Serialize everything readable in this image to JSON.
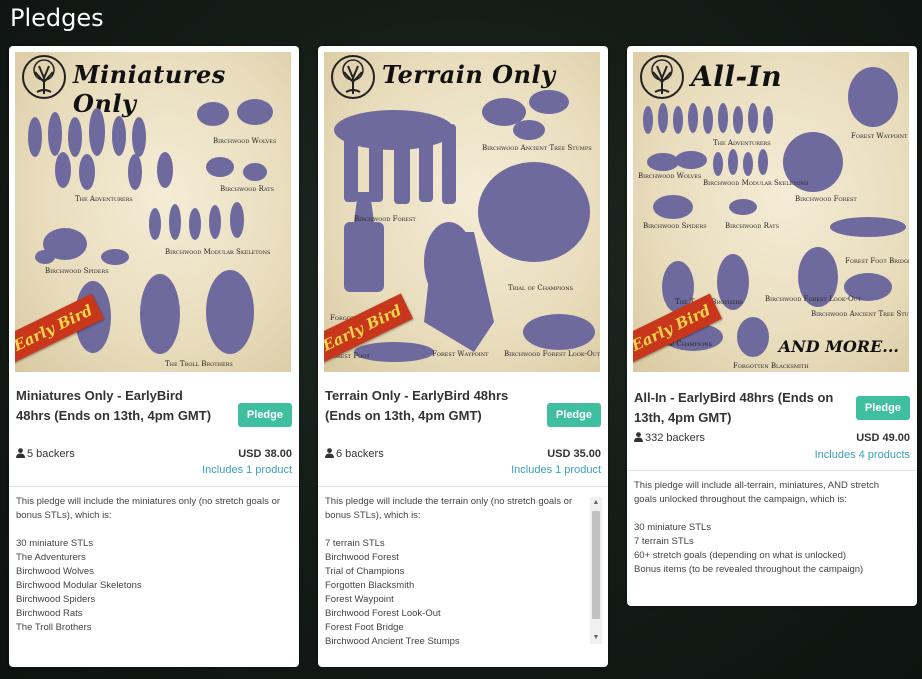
{
  "page": {
    "title": "Pledges"
  },
  "pledges": [
    {
      "banner_title": "Miniatures Only",
      "ribbon": "Early Bird",
      "banner_labels": [
        "The Adventurers",
        "Birchwood Wolves",
        "Birchwood Rats",
        "Birchwood Spiders",
        "Birchwood Modular Skeletons",
        "The Troll Brothers"
      ],
      "title": "Miniatures Only - EarlyBird 48hrs (Ends on 13th, 4pm GMT)",
      "button": "Pledge",
      "backers": "5 backers",
      "price": "USD 38.00",
      "includes": "Includes 1 product",
      "intro": "This pledge will include the miniatures only (no stretch goals or bonus STLs), which is:",
      "items": [
        "30 miniature STLs",
        "The Adventurers",
        "Birchwood Wolves",
        "Birchwood Modular Skeletons",
        "Birchwood Spiders",
        "Birchwood Rats",
        "The Troll Brothers"
      ]
    },
    {
      "banner_title": "Terrain Only",
      "ribbon": "Early Bird",
      "banner_labels": [
        "Birchwood Ancient Tree Stumps",
        "Birchwood Forest",
        "Trial of Champions",
        "Forgotten Blacksmith",
        "Forest Waypoint",
        "Birchwood Forest Look-Out",
        "Forest Foot"
      ],
      "title": "Terrain Only - EarlyBird 48hrs (Ends on 13th, 4pm GMT)",
      "button": "Pledge",
      "backers": "6 backers",
      "price": "USD 35.00",
      "includes": "Includes 1 product",
      "intro": "This pledge will include the terrain only (no stretch goals or bonus STLs), which is:",
      "items": [
        "7 terrain STLs",
        "Birchwood Forest",
        "Trial of Champions",
        "Forgotten Blacksmith",
        "Forest Waypoint",
        "Birchwood Forest Look-Out",
        "Forest Foot Bridge",
        "Birchwood Ancient Tree Stumps"
      ]
    },
    {
      "banner_title": "All-In",
      "ribbon": "Early Bird",
      "banner_more": "AND MORE...",
      "banner_labels": [
        "Forest Waypoint",
        "The Adventurers",
        "Birchwood Wolves",
        "Birchwood Modular Skeletons",
        "Birchwood Forest",
        "Birchwood Spiders",
        "Birchwood Rats",
        "Forest Foot Bridge",
        "The Troll Brothers",
        "Birchwood Forest Look-Out",
        "Birchwood Ancient Tree Stumps",
        "Trial of Champions",
        "Forgotten Blacksmith"
      ],
      "title": "All-In - EarlyBird 48hrs (Ends on 13th, 4pm GMT)",
      "button": "Pledge",
      "backers": "332 backers",
      "price": "USD 49.00",
      "includes": "Includes 4 products",
      "intro": "This pledge will include all-terrain, miniatures, AND stretch goals unlocked throughout the campaign, which is:",
      "items": [
        "30 miniature STLs",
        "7 terrain STLs",
        "60+ stretch goals (depending on what is unlocked)",
        "Bonus items (to be revealed throughout the campaign)"
      ]
    }
  ],
  "colors": {
    "accent": "#3fbfa0",
    "link": "#3aa0b8",
    "ribbon": "#c8361c",
    "miniature": "#6f6a9e"
  },
  "icons": {
    "backers": "user-icon",
    "logo": "tree-of-life-icon"
  }
}
